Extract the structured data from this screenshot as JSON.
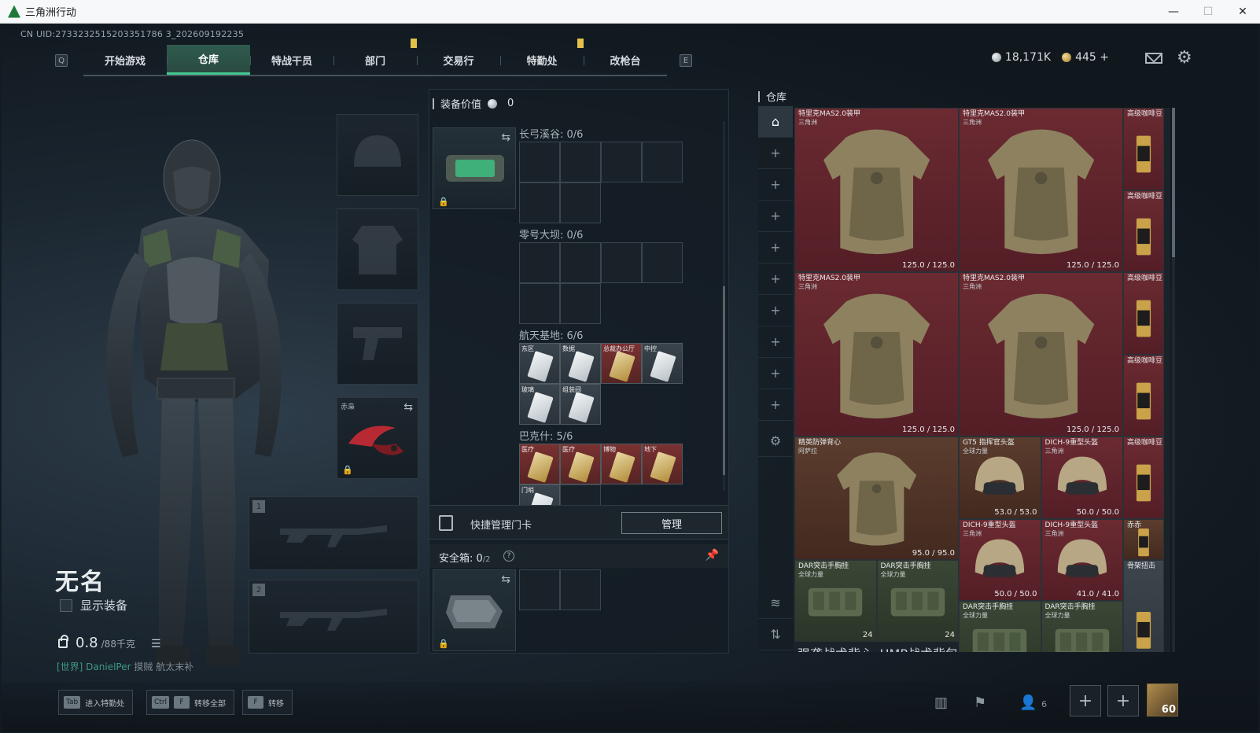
{
  "window": {
    "title": "三角洲行动",
    "minimize": "—",
    "maximize": "☐",
    "close": "✕"
  },
  "uid": "CN UID:2733232515203351786 3_202609192235",
  "nav": {
    "key_left": "Q",
    "key_right": "E",
    "tabs": [
      "开始游戏",
      "仓库",
      "特战干员",
      "部门",
      "交易行",
      "特勤处",
      "改枪台"
    ],
    "active_tab": "仓库"
  },
  "currency": {
    "silver": "18,171K",
    "gold": "445",
    "gold_add": "+"
  },
  "character": {
    "name": "无名",
    "show_equipment": "显示装备",
    "weight": "0.8",
    "weight_max": "/88千克",
    "chat_channel": "[世界] DanielPer",
    "chat_msg": "摸贼 航太末补"
  },
  "slots": {
    "melee_label": "赤枭",
    "gun1_num": "1",
    "gun2_num": "2"
  },
  "middle": {
    "equip_value_label": "装备价值",
    "equip_value": "0",
    "maps": [
      {
        "name": "长弓溪谷: 0/6"
      },
      {
        "name": "零号大坝: 0/6"
      },
      {
        "name": "航天基地: 6/6"
      },
      {
        "name": "巴克什: 5/6"
      }
    ],
    "aerospace_cards": [
      "东区",
      "数据",
      "总裁办公厅",
      "中控",
      "玻璃",
      "组装间"
    ],
    "bakesh_cards": [
      "医疗",
      "医疗",
      "博物",
      "地下",
      "门哨"
    ],
    "quick_manage": "快捷管理门卡",
    "manage_button": "管理",
    "safe_box": "安全箱:",
    "safe_count": "0",
    "safe_total": "/2",
    "help": "?"
  },
  "warehouse": {
    "title": "仓库",
    "items": [
      {
        "name": "特里克MAS2.0装甲",
        "sub": "三角洲",
        "dura": "125.0 / 125.0"
      },
      {
        "name": "特里克MAS2.0装甲",
        "sub": "三角洲",
        "dura": "125.0 / 125.0"
      },
      {
        "name": "特里克MAS2.0装甲",
        "sub": "三角洲",
        "dura": "125.0 / 125.0"
      },
      {
        "name": "特里克MAS2.0装甲",
        "sub": "三角洲",
        "dura": "125.0 / 125.0"
      },
      {
        "name": "精英防弹背心",
        "sub": "阿萨拉",
        "dura": "95.0 / 95.0"
      },
      {
        "name": "GT5 指挥官头盔",
        "sub": "全球力量",
        "dura": "53.0 / 53.0"
      },
      {
        "name": "DICH-9重型头盔",
        "sub": "三角洲",
        "dura": "50.0 / 50.0"
      },
      {
        "name": "DICH-9重型头盔",
        "sub": "三角洲",
        "dura": "50.0 / 50.0"
      },
      {
        "name": "DICH-9重型头盔",
        "sub": "三角洲",
        "dura": "41.0 / 41.0"
      },
      {
        "name": "DAR突击手胸挂",
        "sub": "全球力量",
        "count": "24"
      },
      {
        "name": "DAR突击手胸挂",
        "sub": "全球力量",
        "count": "24"
      },
      {
        "name": "DAR突击手胸挂",
        "sub": "全球力量"
      },
      {
        "name": "DAR突击手胸挂",
        "sub": "全球力量"
      }
    ],
    "side_items": [
      "高级咖啡豆",
      "高级咖啡豆",
      "高级咖啡豆",
      "高级咖啡豆",
      "高级咖啡豆",
      "赤赤",
      "骨架扭击"
    ],
    "bottom_labels": [
      "强袭战术背心",
      "HMP战术背包",
      "骨架扭击"
    ]
  },
  "bottom": {
    "hints": [
      {
        "keys": [
          "Tab"
        ],
        "label": "进入特勤处"
      },
      {
        "keys": [
          "Ctrl",
          "F"
        ],
        "label": "转移全部"
      },
      {
        "keys": [
          "F"
        ],
        "label": "转移"
      }
    ],
    "friends_count": "6",
    "level": "60"
  }
}
